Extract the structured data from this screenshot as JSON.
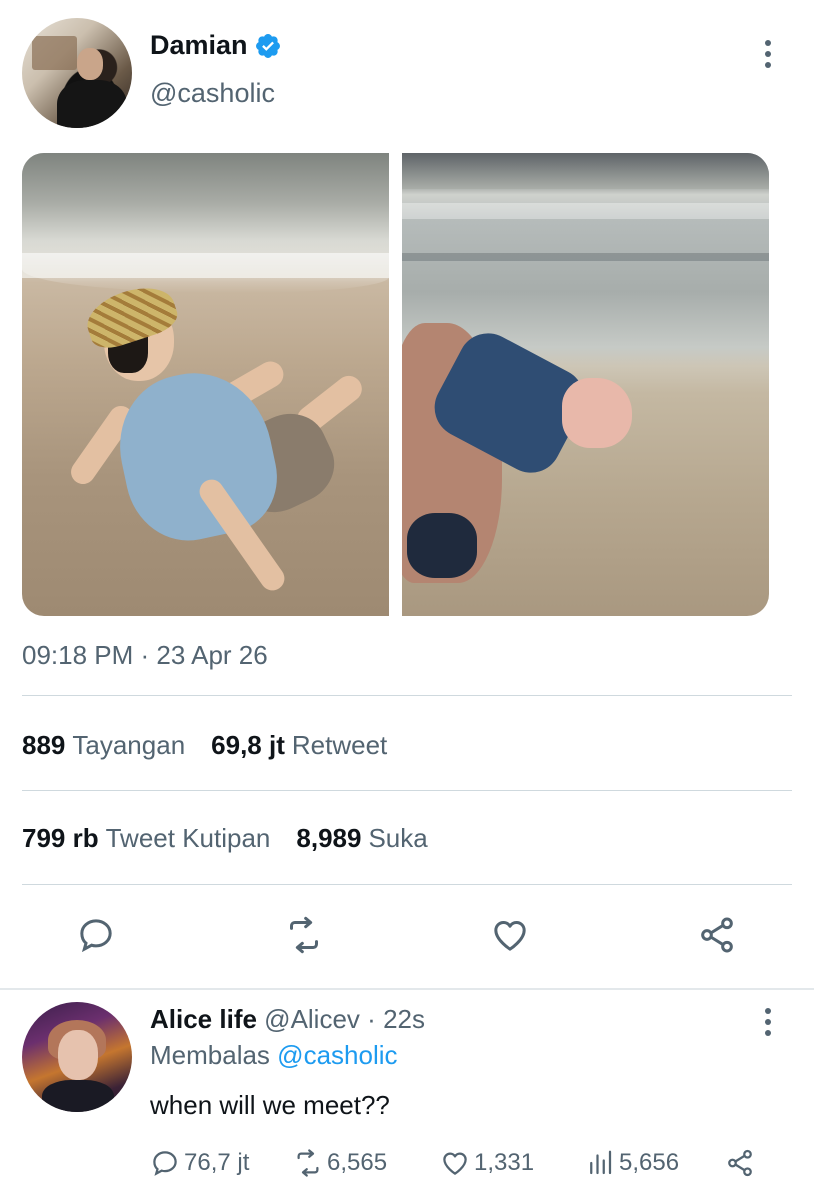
{
  "author": {
    "display_name": "Damian",
    "handle": "@casholic",
    "verified_icon": "verified-badge-icon"
  },
  "tweet": {
    "timestamp": "09:18 PM · 23 Apr 26",
    "stats_row1": [
      {
        "value": "889",
        "label": "Tayangan"
      },
      {
        "value": "69,8 jt",
        "label": "Retweet"
      }
    ],
    "stats_row2": [
      {
        "value": "799 rb",
        "label": "Tweet Kutipan"
      },
      {
        "value": "8,989",
        "label": "Suka"
      }
    ],
    "actions": [
      "reply-icon",
      "retweet-icon",
      "like-icon",
      "share-icon"
    ]
  },
  "reply": {
    "display_name": "Alice life",
    "handle": "@Alicev",
    "dot": "·",
    "time": "22s",
    "replying_prefix": "Membalas",
    "replying_to": "@casholic",
    "text": "when will we meet??",
    "counts": {
      "replies": "76,7 jt",
      "retweets": "6,565",
      "likes": "1,331",
      "views": "5,656"
    }
  },
  "colors": {
    "text_primary": "#0f1419",
    "text_secondary": "#536471",
    "accent": "#1d9bf0",
    "divider": "#cfd9de"
  }
}
